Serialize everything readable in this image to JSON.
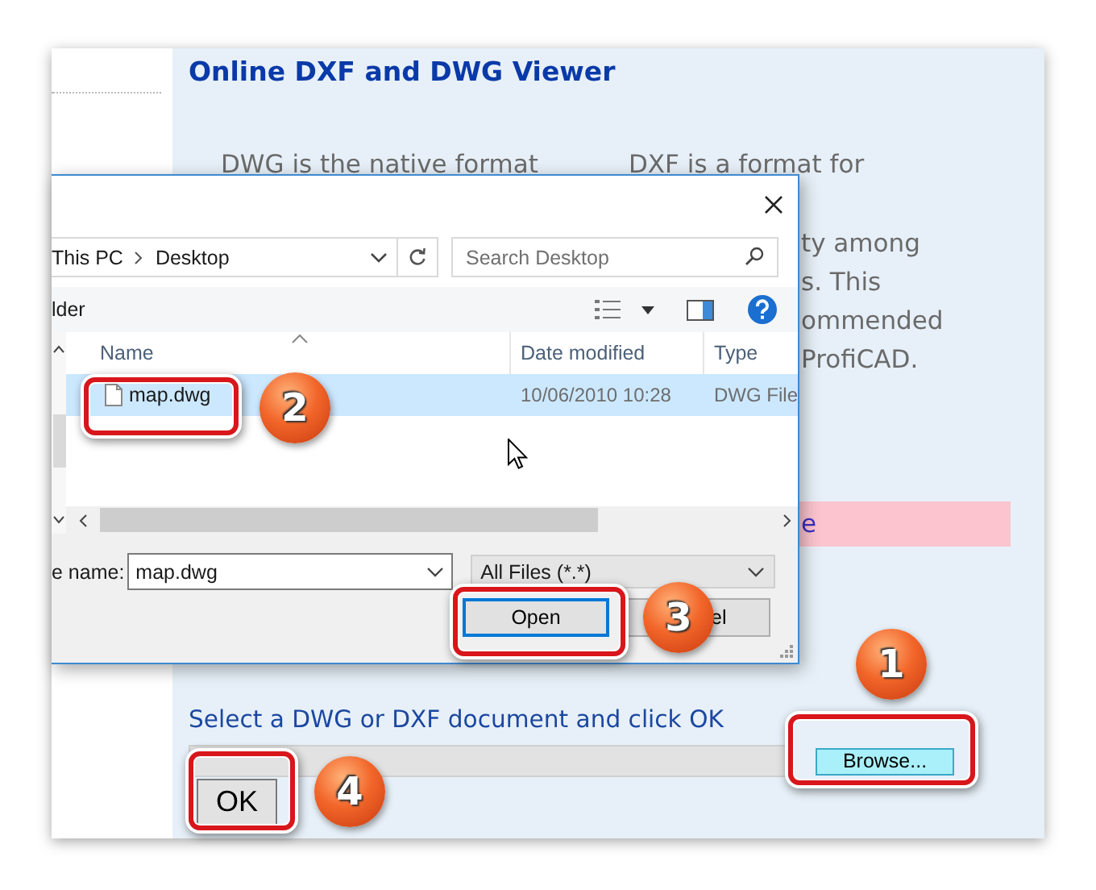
{
  "page": {
    "title": "Online DXF and DWG Viewer",
    "column_1": [
      "DWG is the native format"
    ],
    "column_2": [
      "DXF is a format for",
      "ty among",
      "s. This",
      "ommended",
      "ProfiCAD."
    ],
    "notice": "e",
    "prompt": "Select a DWG or DXF document and click OK",
    "browse_button": "Browse...",
    "ok_button": "OK"
  },
  "dialog": {
    "path": [
      "This PC",
      "Desktop"
    ],
    "search": {
      "placeholder": "Search Desktop"
    },
    "toolbar_button": "lder",
    "columns": [
      "Name",
      "Date modified",
      "Type"
    ],
    "files": [
      {
        "name": "map.dwg",
        "date_modified": "10/06/2010 10:28",
        "type": "DWG File",
        "selected": true
      }
    ],
    "file_name": {
      "label": "e name:",
      "value": "map.dwg"
    },
    "filter": "All Files (*.*)",
    "buttons": [
      {
        "label": "Open",
        "kind": "default"
      },
      {
        "label": "el",
        "kind": "normal"
      }
    ]
  },
  "callouts": [
    {
      "number": "1"
    },
    {
      "number": "2"
    },
    {
      "number": "3"
    },
    {
      "number": "4"
    }
  ]
}
